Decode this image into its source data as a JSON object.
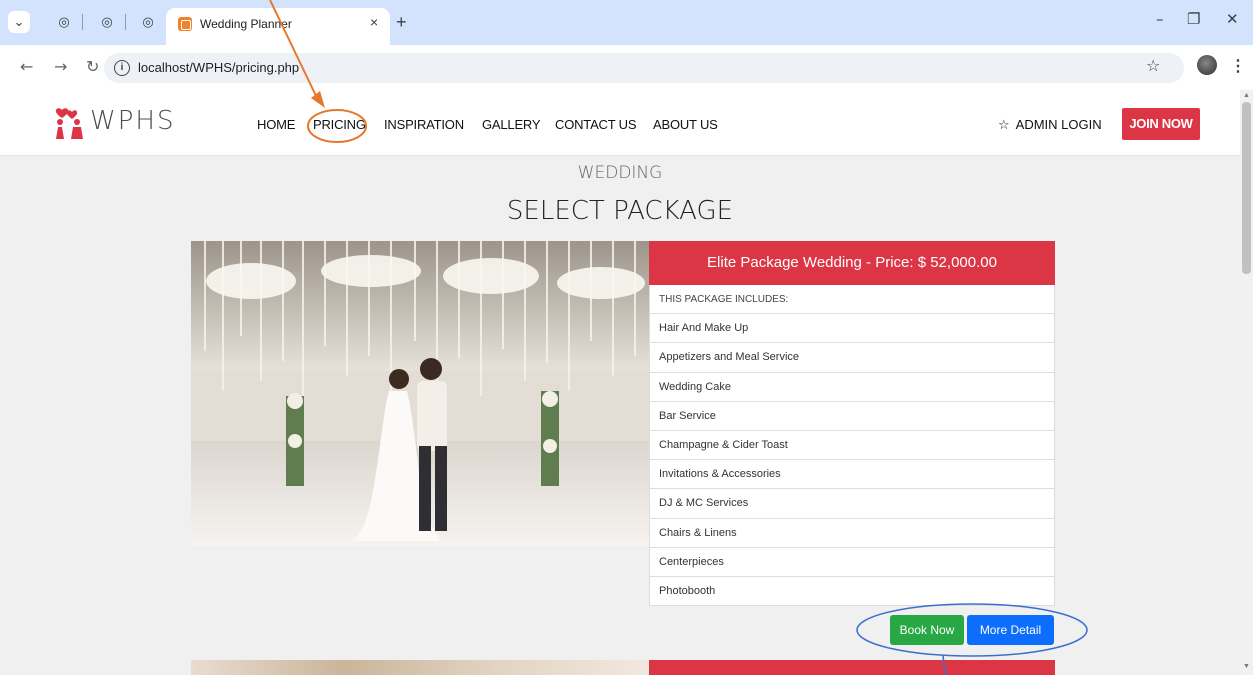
{
  "browser": {
    "tab_title": "Wedding Planner",
    "tab_close": "×",
    "new_tab": "+",
    "url": "localhost/WPHS/pricing.php",
    "icons": [
      "tab-search-icon",
      "globe-icon",
      "favicon-icon",
      "back-icon",
      "forward-icon",
      "reload-icon",
      "info-icon",
      "bookmark-star-icon",
      "profile-icon",
      "menu-icon",
      "minimize-icon",
      "restore-icon",
      "close-icon"
    ]
  },
  "site": {
    "logo_text": "WPHS",
    "nav": [
      "HOME",
      "PRICING",
      "INSPIRATION",
      "GALLERY",
      "CONTACT US",
      "ABOUT US"
    ],
    "admin_login": "ADMIN LOGIN",
    "join_now": "JOIN NOW"
  },
  "content": {
    "kicker": "WEDDING",
    "title": "SELECT PACKAGE",
    "package": {
      "header": "Elite Package Wedding - Price: $ 52,000.00",
      "includes_label": "THIS PACKAGE INCLUDES:",
      "items": [
        "Hair And Make Up",
        "Appetizers and Meal Service",
        "Wedding Cake",
        "Bar Service",
        "Champagne & Cider Toast",
        "Invitations & Accessories",
        "DJ & MC Services",
        "Chairs & Linens",
        "Centerpieces",
        "Photobooth"
      ],
      "book_now": "Book Now",
      "more_detail": "More Detail"
    }
  },
  "colors": {
    "brand_red": "#dc3545",
    "book_green": "#28a745",
    "detail_blue": "#0d6efd",
    "annotation_orange": "#e8772e",
    "annotation_blue": "#3a6fd0"
  }
}
